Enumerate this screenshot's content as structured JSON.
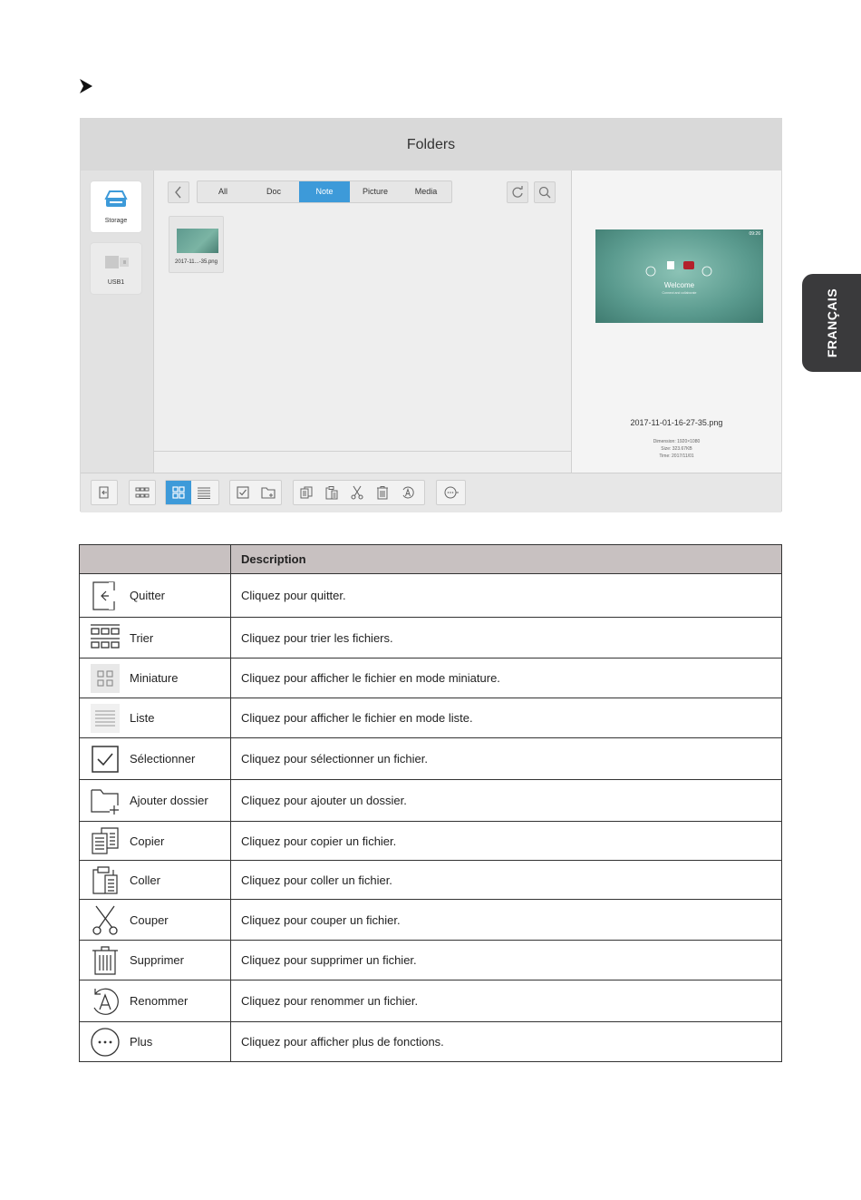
{
  "side_tab": {
    "label": "FRANÇAIS"
  },
  "app": {
    "title": "Folders",
    "sources": [
      {
        "label": "Storage",
        "icon": "storage-icon"
      },
      {
        "label": "USB1",
        "icon": "usb-icon"
      }
    ],
    "tabs": [
      "All",
      "Doc",
      "Note",
      "Picture",
      "Media"
    ],
    "active_tab": "Note",
    "file": {
      "thumb_label": "2017-11...-35.png"
    },
    "preview": {
      "clock": "09:26",
      "welcome": "Welcome",
      "welcome_sub": "Connect and collaborate",
      "filename": "2017-11-01-16-27-35.png",
      "dimension": "Dimension: 1920×1080",
      "size": "Size: 323.67KB",
      "time": "Time: 2017/11/01"
    }
  },
  "table": {
    "header_desc": "Description",
    "rows": [
      {
        "icon": "exit-icon",
        "name": "Quitter",
        "desc": "Cliquez pour quitter."
      },
      {
        "icon": "sort-icon",
        "name": "Trier",
        "desc": "Cliquez pour trier les fichiers."
      },
      {
        "icon": "thumbnail-icon",
        "name": "Miniature",
        "desc": "Cliquez pour afficher le fichier en mode miniature."
      },
      {
        "icon": "list-icon",
        "name": "Liste",
        "desc": "Cliquez pour afficher le fichier en mode liste."
      },
      {
        "icon": "select-icon",
        "name": "Sélectionner",
        "desc": "Cliquez pour sélectionner un fichier."
      },
      {
        "icon": "add-folder-icon",
        "name": "Ajouter dossier",
        "desc": "Cliquez pour ajouter un dossier."
      },
      {
        "icon": "copy-icon",
        "name": "Copier",
        "desc": "Cliquez pour copier un fichier."
      },
      {
        "icon": "paste-icon",
        "name": "Coller",
        "desc": "Cliquez pour coller un fichier."
      },
      {
        "icon": "cut-icon",
        "name": "Couper",
        "desc": "Cliquez pour couper un fichier."
      },
      {
        "icon": "delete-icon",
        "name": "Supprimer",
        "desc": "Cliquez pour supprimer un fichier."
      },
      {
        "icon": "rename-icon",
        "name": "Renommer",
        "desc": "Cliquez pour renommer un fichier."
      },
      {
        "icon": "more-icon",
        "name": "Plus",
        "desc": "Cliquez pour afficher plus de fonctions."
      }
    ]
  },
  "colors": {
    "accent": "#3d9ad9",
    "table_header": "#c8c1c1",
    "side_tab": "#3a3a3c"
  }
}
